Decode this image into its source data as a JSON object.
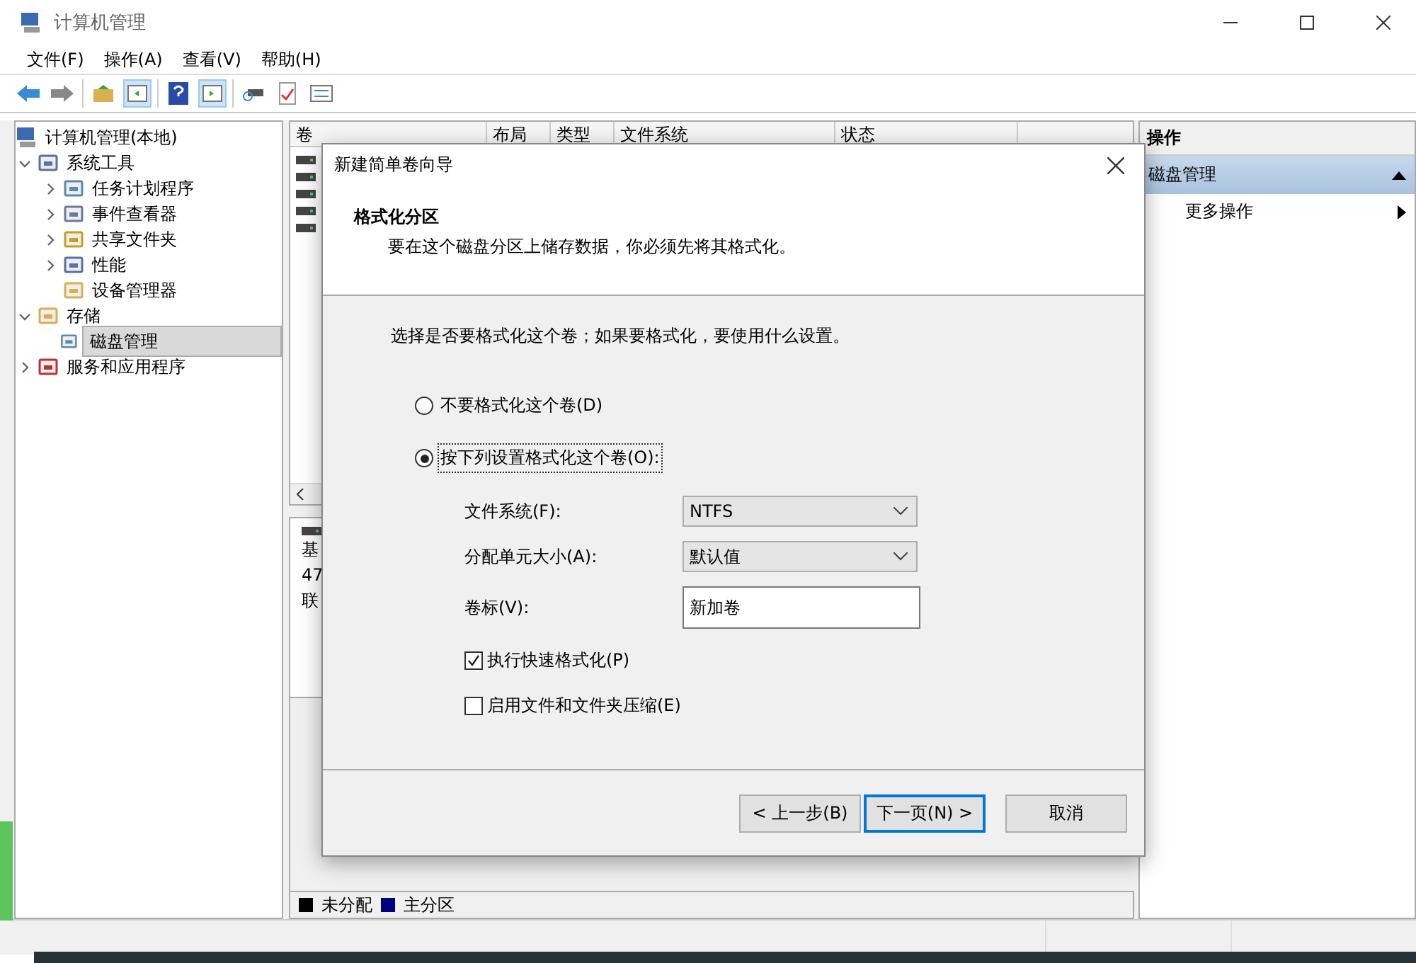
{
  "window": {
    "title": "计算机管理"
  },
  "menu": [
    "文件(F)",
    "操作(A)",
    "查看(V)",
    "帮助(H)"
  ],
  "tree": {
    "label": "计算机管理(本地)",
    "children": [
      {
        "label": "系统工具",
        "expanded": true,
        "selected": false,
        "children": [
          {
            "label": "任务计划程序",
            "expanded": false,
            "selected": false
          },
          {
            "label": "事件查看器",
            "expanded": false,
            "selected": false
          },
          {
            "label": "共享文件夹",
            "expanded": false,
            "selected": false
          },
          {
            "label": "性能",
            "expanded": false,
            "selected": false
          },
          {
            "label": "设备管理器",
            "selected": false
          }
        ]
      },
      {
        "label": "存储",
        "expanded": true,
        "selected": false,
        "children": [
          {
            "label": "磁盘管理",
            "selected": true
          }
        ]
      },
      {
        "label": "服务和应用程序",
        "expanded": false,
        "selected": false
      }
    ]
  },
  "volume_table": {
    "columns": [
      "卷",
      "布局",
      "类型",
      "文件系统",
      "状态"
    ]
  },
  "disk_pane": {
    "lines": [
      "基",
      "47",
      "联"
    ]
  },
  "legend": [
    {
      "label": "未分配",
      "color": "#000000"
    },
    {
      "label": "主分区",
      "color": "#000080"
    }
  ],
  "actions": {
    "title": "操作",
    "section": "磁盘管理",
    "items": [
      "更多操作"
    ]
  },
  "dialog": {
    "title": "新建简单卷向导",
    "heading": "格式化分区",
    "subheading": "要在这个磁盘分区上储存数据，你必须先将其格式化。",
    "prompt": "选择是否要格式化这个卷；如果要格式化，要使用什么设置。",
    "options": [
      {
        "label": "不要格式化这个卷(D)",
        "selected": false
      },
      {
        "label": "按下列设置格式化这个卷(O):",
        "selected": true
      }
    ],
    "fields": [
      {
        "kind": "select",
        "label": "文件系统(F):",
        "value": "NTFS"
      },
      {
        "kind": "select",
        "label": "分配单元大小(A):",
        "value": "默认值"
      },
      {
        "kind": "text",
        "label": "卷标(V):",
        "value": "新加卷"
      }
    ],
    "checkboxes": [
      {
        "label": "执行快速格式化(P)",
        "checked": true
      },
      {
        "label": "启用文件和文件夹压缩(E)",
        "checked": false
      }
    ],
    "buttons": [
      {
        "label": "< 上一步(B)",
        "kind": "normal"
      },
      {
        "label": "下一页(N) >",
        "kind": "default"
      },
      {
        "label": "取消",
        "kind": "cancel"
      }
    ]
  }
}
